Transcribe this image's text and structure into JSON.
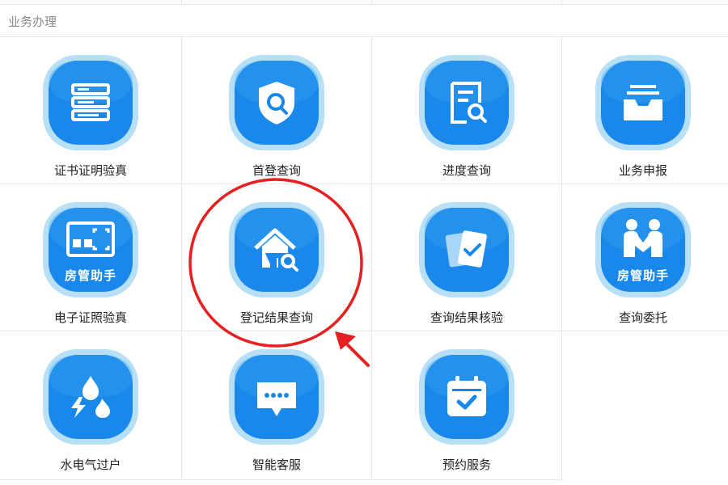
{
  "section": {
    "title": "业务办理"
  },
  "colors": {
    "tile_outer": "#b7dff6",
    "tile_inner": "#1a88ea",
    "annotation": "#e62020"
  },
  "services": [
    {
      "name": "证书证明验真",
      "icon": "document-list-icon",
      "tag": ""
    },
    {
      "name": "首登查询",
      "icon": "shield-search-icon",
      "tag": ""
    },
    {
      "name": "进度查询",
      "icon": "document-search-icon",
      "tag": ""
    },
    {
      "name": "业务申报",
      "icon": "inbox-tray-icon",
      "tag": ""
    },
    {
      "name": "电子证照验真",
      "icon": "scan-frame-icon",
      "tag": "房管助手"
    },
    {
      "name": "登记结果查询",
      "icon": "house-search-icon",
      "tag": ""
    },
    {
      "name": "查询结果核验",
      "icon": "cards-check-icon",
      "tag": ""
    },
    {
      "name": "查询委托",
      "icon": "handshake-icon",
      "tag": "房管助手"
    },
    {
      "name": "水电气过户",
      "icon": "utilities-icon",
      "tag": ""
    },
    {
      "name": "智能客服",
      "icon": "chat-bubble-icon",
      "tag": ""
    },
    {
      "name": "预约服务",
      "icon": "calendar-check-icon",
      "tag": ""
    }
  ]
}
